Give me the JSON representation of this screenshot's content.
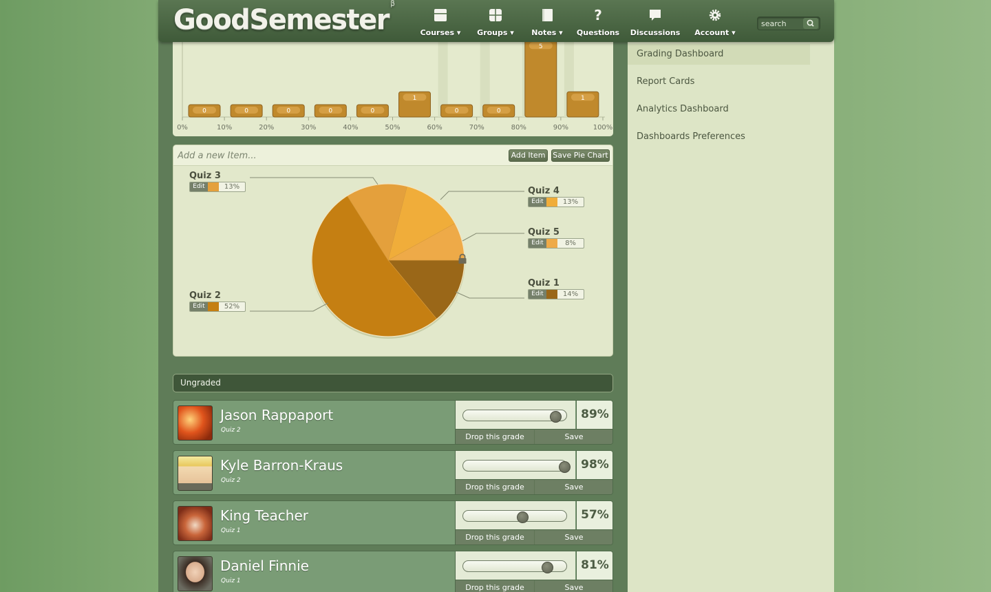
{
  "header": {
    "logo": "GoodSemester",
    "logo_sup": "β",
    "nav": [
      {
        "label": "Courses",
        "icon": "courses-icon",
        "dropdown": true
      },
      {
        "label": "Groups",
        "icon": "groups-icon",
        "dropdown": true
      },
      {
        "label": "Notes",
        "icon": "notes-icon",
        "dropdown": true
      },
      {
        "label": "Questions",
        "icon": "question-icon",
        "dropdown": false
      },
      {
        "label": "Discussions",
        "icon": "discussions-icon",
        "dropdown": false
      },
      {
        "label": "Account",
        "icon": "gear-icon",
        "dropdown": true
      }
    ],
    "search_placeholder": "search"
  },
  "sidebar": {
    "items": [
      {
        "label": "Grading Dashboard",
        "active": true
      },
      {
        "label": "Report Cards",
        "active": false
      },
      {
        "label": "Analytics Dashboard",
        "active": false
      },
      {
        "label": "Dashboards Preferences",
        "active": false
      }
    ]
  },
  "chart_data": [
    {
      "type": "bar",
      "title": "",
      "categories": [
        "0%",
        "10%",
        "20%",
        "30%",
        "40%",
        "50%",
        "60%",
        "70%",
        "80%",
        "90%",
        "100%"
      ],
      "values": [
        0,
        0,
        0,
        0,
        0,
        1,
        0,
        0,
        5,
        1
      ],
      "value_labels": [
        "0",
        "0",
        "0",
        "0",
        "0",
        "1",
        "0",
        "0",
        "5",
        "1"
      ],
      "bar_color": "#c0892c"
    },
    {
      "type": "pie",
      "slices": [
        {
          "label": "Quiz 1",
          "value": 14,
          "pct": "14%",
          "color": "#9a6718"
        },
        {
          "label": "Quiz 2",
          "value": 52,
          "pct": "52%",
          "color": "#c57f12"
        },
        {
          "label": "Quiz 3",
          "value": 13,
          "pct": "13%",
          "color": "#e4a03c"
        },
        {
          "label": "Quiz 4",
          "value": 13,
          "pct": "13%",
          "color": "#f0ad3a"
        },
        {
          "label": "Quiz 5",
          "value": 8,
          "pct": "8%",
          "color": "#eeaa48"
        }
      ]
    }
  ],
  "pie_panel": {
    "input_placeholder": "Add a new Item...",
    "add_item": "Add Item",
    "save_pie_chart": "Save Pie Chart",
    "edit": "Edit"
  },
  "ungraded": {
    "title": "Ungraded",
    "students": [
      {
        "name": "Jason Rappaport",
        "quiz": "Quiz 2",
        "grade": 89,
        "grade_label": "89%"
      },
      {
        "name": "Kyle Barron-Kraus",
        "quiz": "Quiz 2",
        "grade": 98,
        "grade_label": "98%"
      },
      {
        "name": "King Teacher",
        "quiz": "Quiz 1",
        "grade": 57,
        "grade_label": "57%"
      },
      {
        "name": "Daniel Finnie",
        "quiz": "Quiz 1",
        "grade": 81,
        "grade_label": "81%"
      }
    ],
    "drop_label": "Drop this grade",
    "save_label": "Save"
  }
}
